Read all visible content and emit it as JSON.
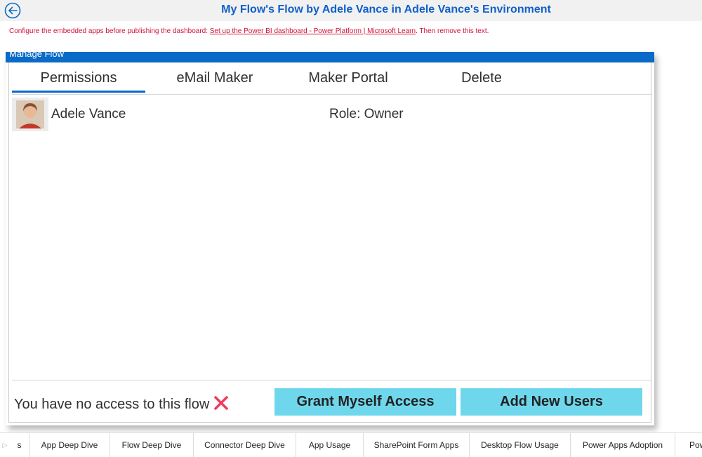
{
  "header": {
    "title": "My Flow's Flow by Adele Vance in Adele Vance's Environment",
    "back_icon": "arrow-left-circle-icon"
  },
  "notice": {
    "prefix": "Configure the embedded apps before publishing the dashboard: ",
    "link": "Set up the Power BI dashboard - Power Platform | Microsoft Learn",
    "suffix": ". Then remove this text."
  },
  "panel": {
    "title": "Manage Flow",
    "tabs": [
      {
        "label": "Permissions",
        "active": true
      },
      {
        "label": "eMail Maker",
        "active": false
      },
      {
        "label": "Maker Portal",
        "active": false
      },
      {
        "label": "Delete",
        "active": false
      }
    ],
    "users": [
      {
        "name": "Adele Vance",
        "role": "Role: Owner"
      }
    ],
    "access_message": "You have no access to this flow",
    "grant_button": "Grant Myself Access",
    "add_users_button": "Add New Users"
  },
  "page_tabs": {
    "items": [
      "s",
      "App Deep Dive",
      "Flow Deep Dive",
      "Connector Deep Dive",
      "App Usage",
      "SharePoint Form Apps",
      "Desktop Flow Usage",
      "Power Apps Adoption",
      "Pow"
    ]
  },
  "colors": {
    "accent": "#0a6ac7",
    "title": "#1060c8",
    "notice": "#d0103a",
    "button": "#6fd7ec",
    "error": "#f03c5a"
  }
}
